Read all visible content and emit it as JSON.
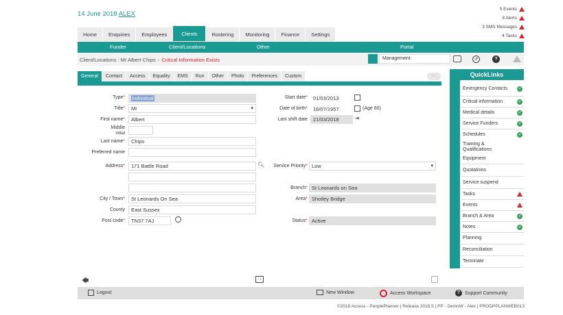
{
  "header": {
    "date": "14 June 2018",
    "user": "ALEX",
    "notices": [
      {
        "label": "5 Events"
      },
      {
        "label": "8 Alerts"
      },
      {
        "label": "3 SMS Messages"
      },
      {
        "label": "4 Tasks"
      }
    ]
  },
  "main_tabs": [
    {
      "label": "Home"
    },
    {
      "label": "Enquiries"
    },
    {
      "label": "Employees"
    },
    {
      "label": "Clients",
      "active": true
    },
    {
      "label": "Rostering"
    },
    {
      "label": "Monitoring"
    },
    {
      "label": "Finance"
    },
    {
      "label": "Settings"
    }
  ],
  "sub_nav": [
    "Funder",
    "Client/Locations",
    "Other",
    "Portal"
  ],
  "context": {
    "label": "Client/Locations : Mr Albert Chips",
    "separator": "-",
    "warning": "Critical Information Exists",
    "dropdown": "Management"
  },
  "sub_tabs": [
    {
      "label": "General",
      "active": true
    },
    {
      "label": "Contact"
    },
    {
      "label": "Access"
    },
    {
      "label": "Equality"
    },
    {
      "label": "EMS"
    },
    {
      "label": "Run"
    },
    {
      "label": "Other"
    },
    {
      "label": "Photo"
    },
    {
      "label": "Preferences"
    },
    {
      "label": "Custom"
    }
  ],
  "form": {
    "type_label": "Type",
    "type_value": "Individual",
    "title_label": "Title",
    "title_value": "Mr",
    "first_name_label": "First name",
    "first_name_value": "Albert",
    "middle_label": "Middle",
    "middle_label_2": "initial",
    "last_name_label": "Last name",
    "last_name_value": "Chips",
    "preferred_label": "Preferred name",
    "address_label": "Address",
    "address_value": "171 Battle Road",
    "city_label": "City / Town",
    "city_value": "St Leonards On Sea",
    "county_label": "County",
    "county_value": "East Sussex",
    "postcode_label": "Post code",
    "postcode_value": "TN37 7AJ",
    "start_date_label": "Start date",
    "start_date_value": "01/03/2013",
    "dob_label": "Date of birth",
    "dob_value": "16/07/1957",
    "age_text": "(Age 60)",
    "last_shift_label": "Last shift date",
    "last_shift_value": "21/03/2018",
    "service_priority_label": "Service Priority",
    "service_priority_value": "Low",
    "branch_label": "Branch",
    "branch_value": "St Leonards on Sea",
    "area_label": "Area",
    "area_value": "Shotley Bridge",
    "status_label": "Status",
    "status_value": "Active",
    "required_mark": "*"
  },
  "quicklinks": {
    "title": "QuickLinks",
    "items": [
      {
        "label": "Emergency Contacts",
        "status": "ok"
      },
      {
        "label": "Critical information",
        "status": "ok"
      },
      {
        "label": "Medical details",
        "status": "ok"
      },
      {
        "label": "Service Funders",
        "status": "ok"
      },
      {
        "label": "Schedules",
        "status": "ok"
      },
      {
        "label": "Training & Qualifications",
        "status": "none"
      },
      {
        "label": "Equipment",
        "status": "none"
      },
      {
        "label": "Quotations",
        "status": "none"
      },
      {
        "label": "Service suspend",
        "status": "none"
      },
      {
        "label": "Tasks",
        "status": "warn"
      },
      {
        "label": "Events",
        "status": "warn"
      },
      {
        "label": "Branch & Area",
        "status": "ok"
      },
      {
        "label": "Notes",
        "status": "ok"
      },
      {
        "label": "Planning",
        "status": "none"
      },
      {
        "label": "Reconciliation",
        "status": "none"
      },
      {
        "label": "Terminate",
        "status": "none"
      }
    ]
  },
  "footer": {
    "logout": "Logout",
    "new_window": "New Window",
    "access_workspace": "Access Workspace",
    "support": "Support Community",
    "copyright": "©2018 Access - PeoplePlanner | Release 2018.5 | PP - DemoW - Alex | PRODPPLANWEB013"
  },
  "colors": {
    "accent": "#1a9a93",
    "warning": "#d9232d",
    "ok": "#3aa35a"
  }
}
